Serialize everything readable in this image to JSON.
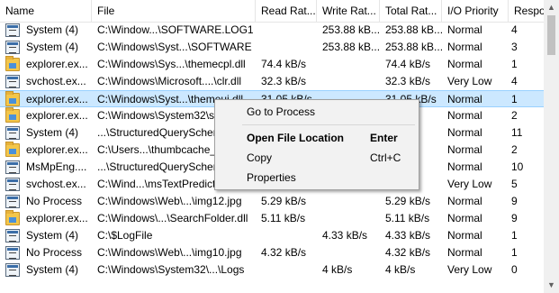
{
  "columns": [
    "Name",
    "File",
    "Read Rat...",
    "Write Rat...",
    "Total Rat...",
    "I/O Priority",
    "Respo"
  ],
  "rows": [
    {
      "icon": "window-icon",
      "name": "System (4)",
      "file": "C:\\Window...\\SOFTWARE.LOG1",
      "read": "",
      "write": "253.88 kB...",
      "total": "253.88 kB...",
      "prio": "Normal",
      "resp": "4"
    },
    {
      "icon": "window-icon",
      "name": "System (4)",
      "file": "C:\\Windows\\Syst...\\SOFTWARE",
      "read": "",
      "write": "253.88 kB...",
      "total": "253.88 kB...",
      "prio": "Normal",
      "resp": "3"
    },
    {
      "icon": "folder-icon",
      "name": "explorer.ex...",
      "file": "C:\\Windows\\Sys...\\themecpl.dll",
      "read": "74.4 kB/s",
      "write": "",
      "total": "74.4 kB/s",
      "prio": "Normal",
      "resp": "1"
    },
    {
      "icon": "window-icon",
      "name": "svchost.ex...",
      "file": "C:\\Windows\\Microsoft....\\clr.dll",
      "read": "32.3 kB/s",
      "write": "",
      "total": "32.3 kB/s",
      "prio": "Very Low",
      "resp": "4"
    },
    {
      "icon": "folder-icon",
      "name": "explorer.ex...",
      "file": "C:\\Windows\\Syst...\\themeui.dll",
      "read": "31.05 kB/s",
      "write": "",
      "total": "31.05 kB/s",
      "prio": "Normal",
      "resp": "1"
    },
    {
      "icon": "folder-icon",
      "name": "explorer.ex...",
      "file": "C:\\Windows\\System32\\s",
      "read": "",
      "write": "",
      "total": "",
      "prio": "Normal",
      "resp": "2"
    },
    {
      "icon": "window-icon",
      "name": "System (4)",
      "file": "...\\StructuredQueryScher",
      "read": "",
      "write": "",
      "total": "",
      "prio": "Normal",
      "resp": "11"
    },
    {
      "icon": "folder-icon",
      "name": "explorer.ex...",
      "file": "C:\\Users...\\thumbcache_",
      "read": "",
      "write": "",
      "total": "",
      "prio": "Normal",
      "resp": "2"
    },
    {
      "icon": "window-icon",
      "name": "MsMpEng....",
      "file": "...\\StructuredQueryScher",
      "read": "",
      "write": "",
      "total": "",
      "prio": "Normal",
      "resp": "10"
    },
    {
      "icon": "window-icon",
      "name": "svchost.ex...",
      "file": "C:\\Wind...\\msTextPredict",
      "read": "",
      "write": "",
      "total": "",
      "prio": "Very Low",
      "resp": "5"
    },
    {
      "icon": "window-icon",
      "name": "No Process",
      "file": "C:\\Windows\\Web\\...\\img12.jpg",
      "read": "5.29 kB/s",
      "write": "",
      "total": "5.29 kB/s",
      "prio": "Normal",
      "resp": "9"
    },
    {
      "icon": "folder-icon",
      "name": "explorer.ex...",
      "file": "C:\\Windows\\...\\SearchFolder.dll",
      "read": "5.11 kB/s",
      "write": "",
      "total": "5.11 kB/s",
      "prio": "Normal",
      "resp": "9"
    },
    {
      "icon": "window-icon",
      "name": "System (4)",
      "file": "C:\\$LogFile",
      "read": "",
      "write": "4.33 kB/s",
      "total": "4.33 kB/s",
      "prio": "Normal",
      "resp": "1"
    },
    {
      "icon": "window-icon",
      "name": "No Process",
      "file": "C:\\Windows\\Web\\...\\img10.jpg",
      "read": "4.32 kB/s",
      "write": "",
      "total": "4.32 kB/s",
      "prio": "Normal",
      "resp": "1"
    },
    {
      "icon": "window-icon",
      "name": "System (4)",
      "file": "C:\\Windows\\System32\\...\\Logs",
      "read": "",
      "write": "4 kB/s",
      "total": "4 kB/s",
      "prio": "Very Low",
      "resp": "0"
    }
  ],
  "selected_row": 4,
  "context_menu": {
    "items": [
      {
        "label": "Go to Process",
        "shortcut": ""
      },
      {
        "label": "Open File Location",
        "shortcut": "Enter",
        "bold": true
      },
      {
        "label": "Copy",
        "shortcut": "Ctrl+C"
      },
      {
        "label": "Properties",
        "shortcut": ""
      }
    ]
  },
  "scrollbar": {
    "up_glyph": "▲",
    "down_glyph": "▼"
  },
  "colors": {
    "selection": "#cce8ff",
    "selection_border": "#99d1ff",
    "menu_bg": "#f2f2f2"
  }
}
